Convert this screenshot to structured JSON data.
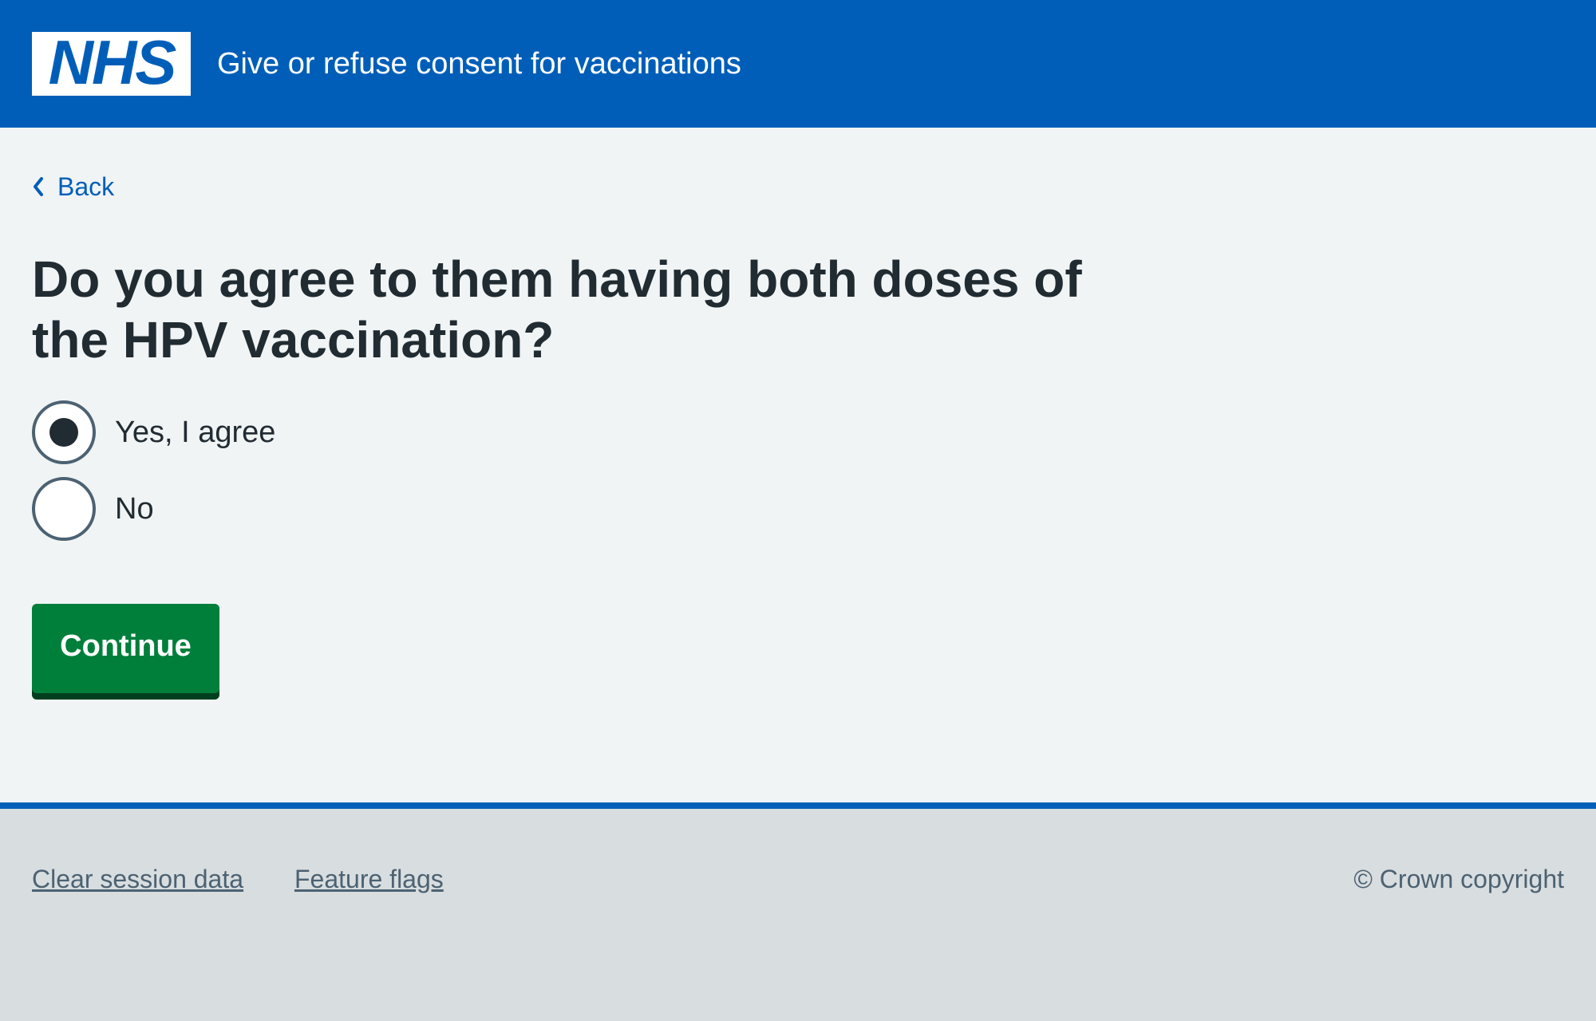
{
  "header": {
    "logo_text": "NHS",
    "service_name": "Give or refuse consent for vaccinations"
  },
  "back_link": {
    "label": "Back",
    "icon": "chevron-left-icon"
  },
  "question": {
    "title": "Do you agree to them having both doses of the HPV vaccination?",
    "options": [
      {
        "label": "Yes, I agree",
        "selected": true
      },
      {
        "label": "No",
        "selected": false
      }
    ]
  },
  "continue_button": {
    "label": "Continue"
  },
  "footer": {
    "links": [
      {
        "label": "Clear session data"
      },
      {
        "label": "Feature flags"
      }
    ],
    "copyright": "© Crown copyright"
  },
  "colors": {
    "brand_blue": "#005eb8",
    "button_green": "#007f3b",
    "button_shadow": "#00401e",
    "text_dark": "#212b32",
    "text_secondary": "#4c6272",
    "page_background": "#f0f4f5",
    "footer_background": "#d8dde0"
  }
}
